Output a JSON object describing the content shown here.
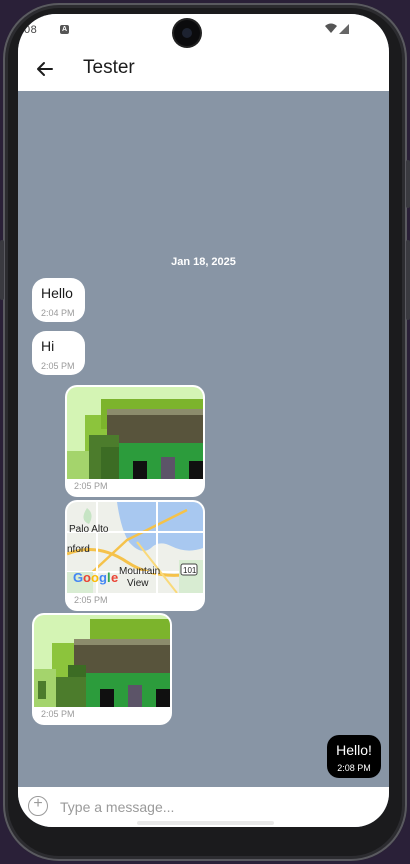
{
  "status": {
    "time": "08",
    "notif_icon": "android-notif-icon",
    "icons": "wifi-signal-icons"
  },
  "app": {
    "title": "Tester"
  },
  "chat": {
    "date": "Jan 18, 2025",
    "messages": [
      {
        "type": "text",
        "text": "Hello",
        "time": "2:04 PM"
      },
      {
        "type": "text",
        "text": "Hi",
        "time": "2:05 PM"
      },
      {
        "type": "image",
        "time": "2:05 PM"
      },
      {
        "type": "map",
        "time": "2:05 PM",
        "labels": [
          "Palo Alto",
          "nford",
          "Mountain",
          "View",
          "101"
        ]
      },
      {
        "type": "image",
        "time": "2:05 PM"
      }
    ],
    "outgoing": {
      "text": "Hello!",
      "time": "2:08 PM"
    }
  },
  "composer": {
    "placeholder": "Type a message..."
  },
  "colors": {
    "chat_bg": "#8895a5",
    "bubble_in": "#ffffff",
    "bubble_out": "#000000"
  }
}
